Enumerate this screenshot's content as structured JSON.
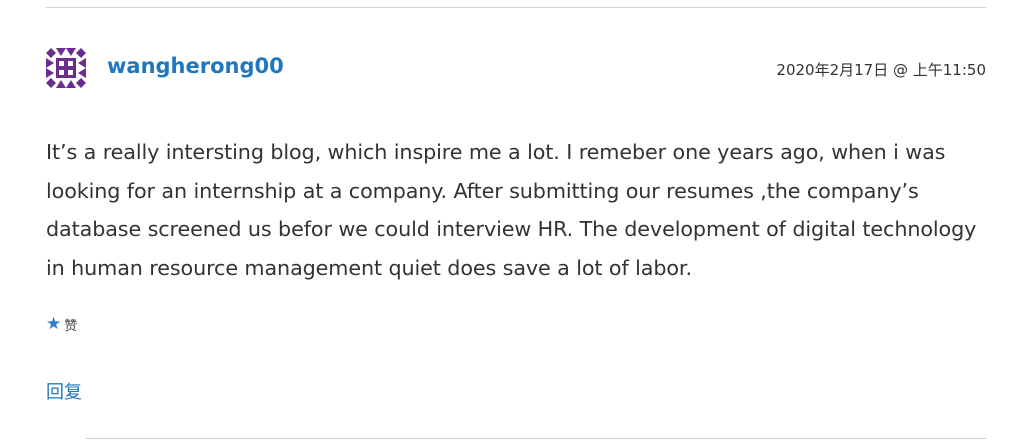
{
  "comment": {
    "author": "wangherong00",
    "avatar_icon": "identicon-avatar",
    "avatar_color": "#6b2d8f",
    "meta": "2020年2月17日 @ 上午11:50",
    "text": "It’s a really intersting blog, which inspire me a lot. I remeber one years ago, when i was looking for an internship at a company. After submitting our resumes ,the company’s database screened us befor we could interview HR. The development of digital technology in human resource management quiet does save a lot of labor.",
    "like_icon": "star-icon",
    "like_label": "赞",
    "reply_label": "回复",
    "link_color": "#1f78bf"
  }
}
